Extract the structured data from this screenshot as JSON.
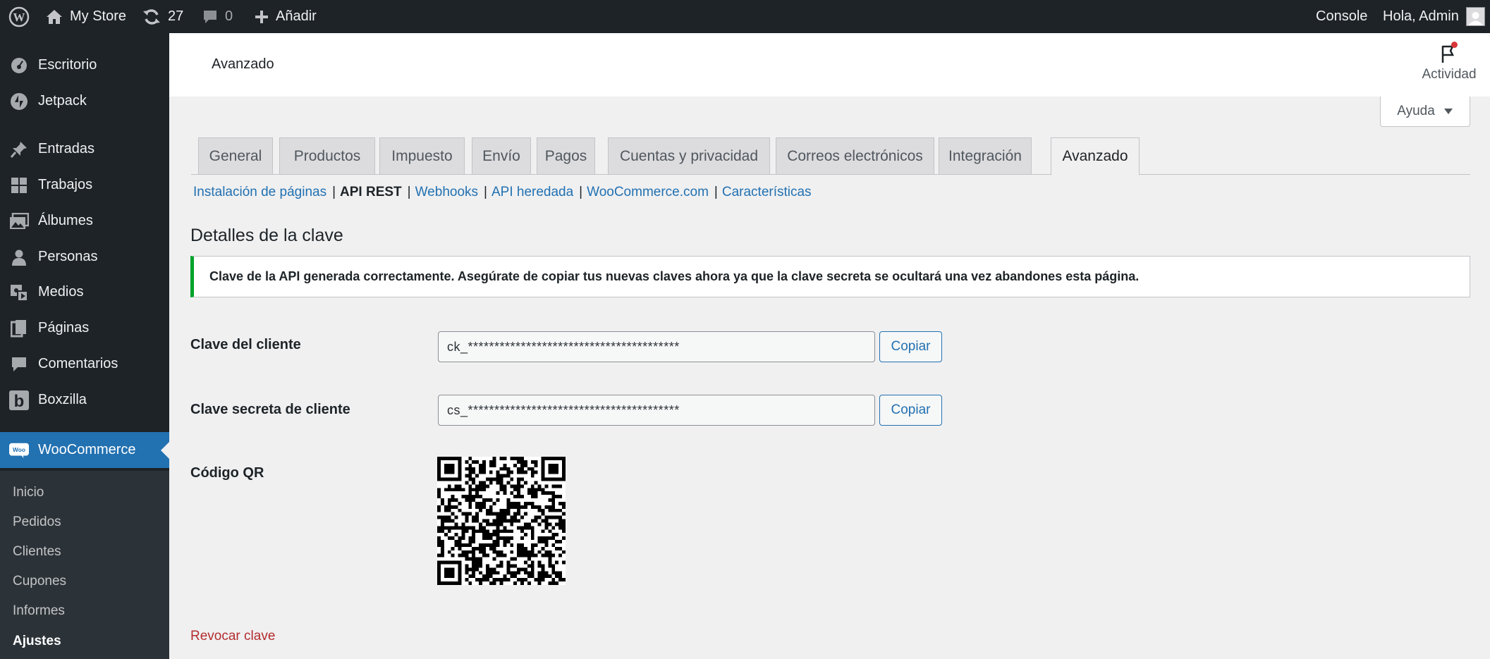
{
  "adminbar": {
    "site_name": "My Store",
    "updates_count": "27",
    "comments_count": "0",
    "add_new_label": "Añadir",
    "console_label": "Console",
    "greeting": "Hola, Admin"
  },
  "sidebar": {
    "items": [
      {
        "label": "Escritorio",
        "icon": "dashboard-icon"
      },
      {
        "label": "Jetpack",
        "icon": "jetpack-icon"
      },
      {
        "label": "Entradas",
        "icon": "pin-icon"
      },
      {
        "label": "Trabajos",
        "icon": "grid-icon"
      },
      {
        "label": "Álbumes",
        "icon": "images-icon"
      },
      {
        "label": "Personas",
        "icon": "person-icon"
      },
      {
        "label": "Medios",
        "icon": "media-icon"
      },
      {
        "label": "Páginas",
        "icon": "page-icon"
      },
      {
        "label": "Comentarios",
        "icon": "comment-icon"
      },
      {
        "label": "Boxzilla",
        "icon": "boxzilla-icon"
      },
      {
        "label": "WooCommerce",
        "icon": "woo-icon"
      }
    ],
    "submenu": [
      "Inicio",
      "Pedidos",
      "Clientes",
      "Cupones",
      "Informes",
      "Ajustes"
    ]
  },
  "header": {
    "title": "Avanzado",
    "activity_label": "Actividad",
    "help_label": "Ayuda"
  },
  "tabs": [
    "General",
    "Productos",
    "Impuesto",
    "Envío",
    "Pagos",
    "Cuentas y privacidad",
    "Correos electrónicos",
    "Integración",
    "Avanzado"
  ],
  "subsub": {
    "links": [
      "Instalación de páginas",
      "API REST",
      "Webhooks",
      "API heredada",
      "WooCommerce.com",
      "Características"
    ],
    "current": "API REST"
  },
  "section_title": "Detalles de la clave",
  "notice": "Clave de la API generada correctamente. Asegúrate de copiar tus nuevas claves ahora ya que la clave secreta se ocultará una vez abandones esta página.",
  "form": {
    "consumer_key_label": "Clave del cliente",
    "consumer_key_value": "ck_****************************************",
    "consumer_secret_label": "Clave secreta de cliente",
    "consumer_secret_value": "cs_****************************************",
    "copy_label": "Copiar",
    "qr_label": "Código QR"
  },
  "revoke_label": "Revocar clave",
  "colors": {
    "adminbar_bg": "#1d2327",
    "accent": "#2271b1",
    "success": "#00a32a",
    "danger": "#b32d2e"
  }
}
